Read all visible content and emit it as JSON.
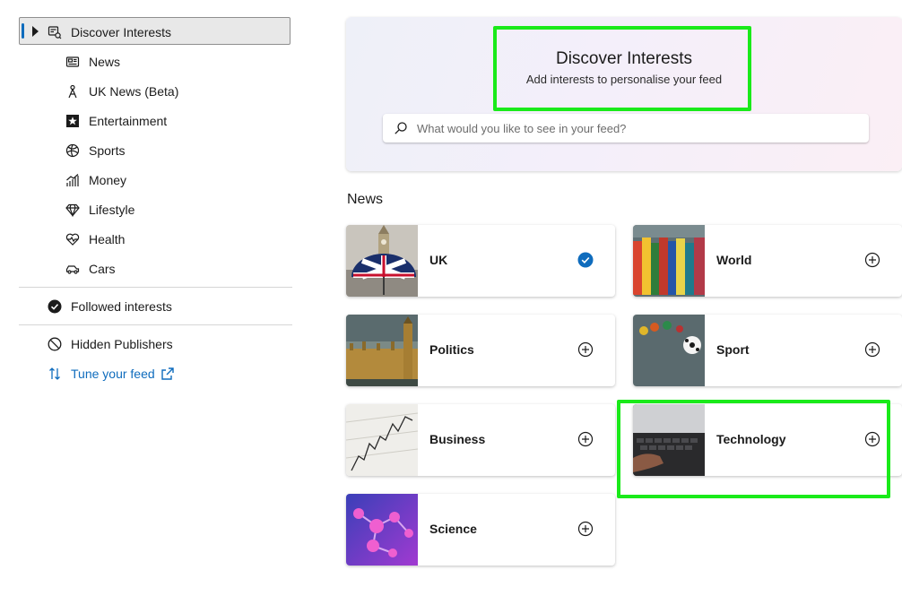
{
  "sidebar": {
    "active": {
      "label": "Discover Interests",
      "icon": "discover-icon"
    },
    "categories": [
      {
        "label": "News",
        "icon": "newspaper-icon"
      },
      {
        "label": "UK News (Beta)",
        "icon": "person-pin-icon"
      },
      {
        "label": "Entertainment",
        "icon": "star-icon"
      },
      {
        "label": "Sports",
        "icon": "ball-icon"
      },
      {
        "label": "Money",
        "icon": "chart-icon"
      },
      {
        "label": "Lifestyle",
        "icon": "diamond-icon"
      },
      {
        "label": "Health",
        "icon": "heart-pulse-icon"
      },
      {
        "label": "Cars",
        "icon": "car-icon"
      }
    ],
    "followed": {
      "label": "Followed interests",
      "icon": "check-circle-icon"
    },
    "hidden": {
      "label": "Hidden Publishers",
      "icon": "block-icon"
    },
    "tune": {
      "label": "Tune your feed",
      "icon": "sort-arrows-icon",
      "external_icon": "external-link-icon"
    }
  },
  "hero": {
    "title": "Discover Interests",
    "subtitle": "Add interests to personalise your feed",
    "search_placeholder": "What would you like to see in your feed?"
  },
  "section": {
    "title": "News"
  },
  "cards": [
    {
      "label": "UK",
      "followed": true
    },
    {
      "label": "World",
      "followed": false
    },
    {
      "label": "Politics",
      "followed": false
    },
    {
      "label": "Sport",
      "followed": false
    },
    {
      "label": "Business",
      "followed": false
    },
    {
      "label": "Technology",
      "followed": false
    },
    {
      "label": "Science",
      "followed": false
    }
  ],
  "colors": {
    "accent": "#0f6cbd",
    "highlight": "#1aea1a",
    "text": "#1b1b1b"
  }
}
